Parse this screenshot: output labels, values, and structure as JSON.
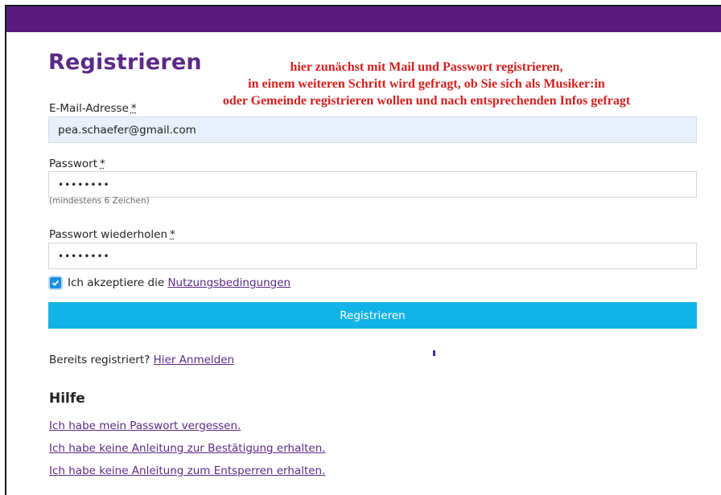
{
  "page": {
    "title": "Registrieren",
    "annotation": [
      "hier zunächst mit Mail und Passwort registrieren,",
      "in einem weiteren Schritt wird gefragt, ob Sie sich als Musiker:in",
      "oder Gemeinde registrieren wollen und nach entsprechenden Infos gefragt"
    ]
  },
  "colors": {
    "brand_bar": "#5a1a80",
    "title": "#5b2a86",
    "button": "#12b3e6",
    "annotation": "#d0201e",
    "link": "#5b2a86"
  },
  "form": {
    "email": {
      "label": "E-Mail-Adresse",
      "required_mark": "*",
      "value": "pea.schaefer@gmail.com"
    },
    "password": {
      "label": "Passwort",
      "required_mark": "*",
      "value": "••••••••",
      "hint": "(mindestens 6 Zeichen)"
    },
    "password_repeat": {
      "label": "Passwort wiederholen",
      "required_mark": "*",
      "value": "••••••••"
    },
    "terms": {
      "checked": true,
      "text": "Ich akzeptiere die",
      "link": "Nutzungsbedingungen",
      "icon": "checkmark-icon"
    },
    "submit_label": "Registrieren"
  },
  "login": {
    "text": "Bereits registriert?",
    "link": "Hier Anmelden"
  },
  "help": {
    "title": "Hilfe",
    "links": [
      "Ich habe mein Passwort vergessen.",
      "Ich habe keine Anleitung zur Bestätigung erhalten.",
      "Ich habe keine Anleitung zum Entsperren erhalten."
    ]
  }
}
